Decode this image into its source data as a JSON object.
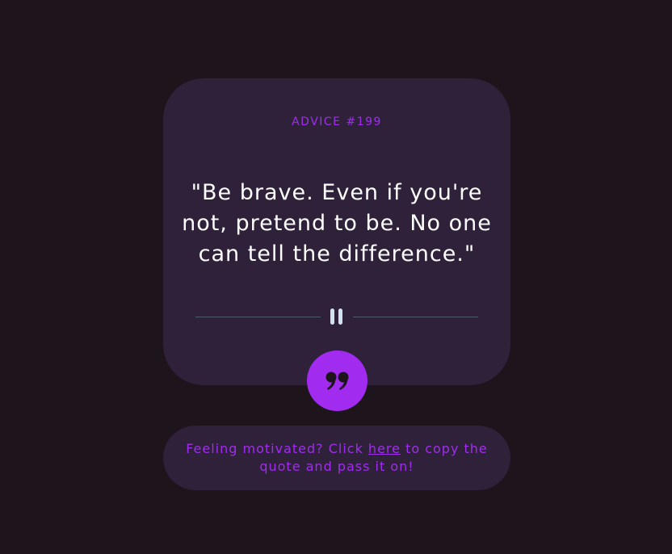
{
  "card": {
    "advice_label": "ADVICE #199",
    "quote": "\"Be brave. Even if you're not, pretend to be. No one can tell the difference.\""
  },
  "divider": {
    "icon": "pause-icon"
  },
  "dice_button": {
    "icon": "quote-mark-icon"
  },
  "footer": {
    "text_before": "Feeling motivated? Click ",
    "link_label": "here",
    "text_after": " to copy the quote and pass it on!"
  },
  "colors": {
    "background": "#1e141c",
    "card": "#2e2139",
    "accent": "#a12cf0",
    "divider_line": "#4e5a6b",
    "pause_icon": "#cfe3ef"
  }
}
